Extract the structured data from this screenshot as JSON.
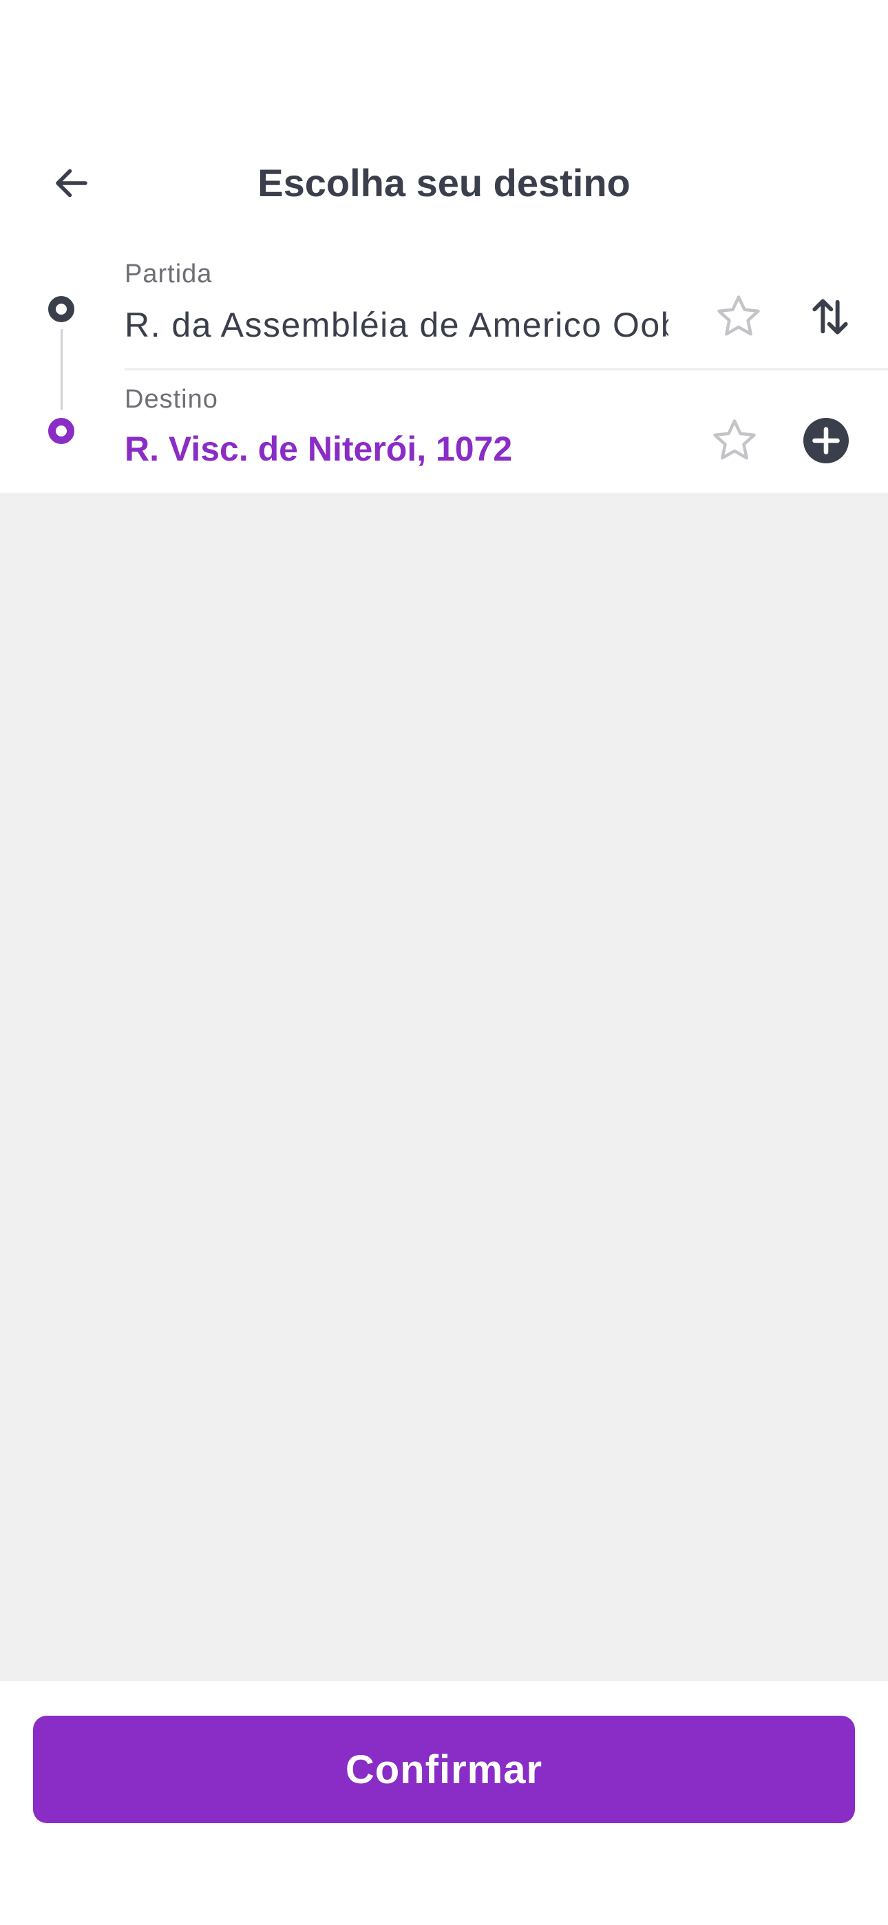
{
  "header": {
    "title": "Escolha seu destino",
    "back_icon": "arrow-left-icon"
  },
  "route": {
    "origin": {
      "label": "Partida",
      "value": "R. da Assembléia de Americo Oob",
      "favorite_icon": "star-outline-icon",
      "action_icon": "swap-vertical-icon"
    },
    "destination": {
      "label": "Destino",
      "value": "R. Visc. de Niterói, 1072",
      "favorite_icon": "star-outline-icon",
      "action_icon": "add-circle-icon"
    }
  },
  "footer": {
    "confirm_label": "Confirmar"
  },
  "colors": {
    "accent": "#8a2cc6",
    "text_dark": "#3a3f4b",
    "text_muted": "#6e6e76",
    "star_gray": "#c4c4c8",
    "content_background": "#f0f0f0"
  }
}
